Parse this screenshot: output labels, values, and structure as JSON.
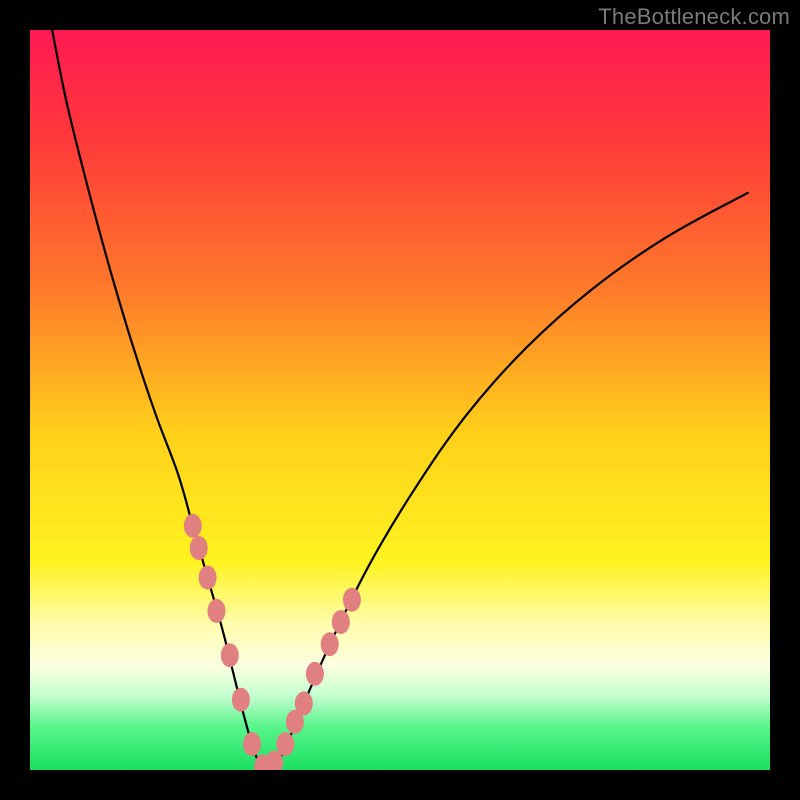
{
  "watermark": "TheBottleneck.com",
  "colors": {
    "frame": "#000000",
    "curve": "#000000",
    "marker_fill": "#e08080",
    "marker_stroke": "#c86868",
    "gradient_stops": [
      {
        "offset": 0.0,
        "color": "#ff1a52"
      },
      {
        "offset": 0.15,
        "color": "#ff3a3a"
      },
      {
        "offset": 0.35,
        "color": "#ff7a2a"
      },
      {
        "offset": 0.55,
        "color": "#ffd21a"
      },
      {
        "offset": 0.72,
        "color": "#fff321"
      },
      {
        "offset": 0.8,
        "color": "#fffca8"
      },
      {
        "offset": 0.86,
        "color": "#fbffe2"
      },
      {
        "offset": 0.9,
        "color": "#c4ffd0"
      },
      {
        "offset": 0.94,
        "color": "#5cf58c"
      },
      {
        "offset": 1.0,
        "color": "#18e060"
      }
    ]
  },
  "chart_data": {
    "type": "line",
    "title": "",
    "xlabel": "",
    "ylabel": "",
    "xlim": [
      0,
      100
    ],
    "ylim": [
      0,
      100
    ],
    "series": [
      {
        "name": "bottleneck-curve",
        "x": [
          3,
          5,
          8,
          11,
          14,
          17,
          20,
          22,
          24,
          26,
          27.5,
          29,
          30.5,
          32,
          34,
          37,
          41,
          46,
          52,
          59,
          67,
          76,
          86,
          97
        ],
        "values": [
          100,
          90,
          78,
          67,
          57,
          48,
          40,
          33,
          26,
          19,
          13,
          7,
          2,
          0,
          2,
          9,
          18,
          28,
          38,
          48,
          57,
          65,
          72,
          78
        ]
      }
    ],
    "markers": {
      "name": "highlighted-points",
      "x": [
        22.0,
        22.8,
        24.0,
        25.2,
        27.0,
        28.5,
        30.0,
        31.5,
        33.0,
        34.5,
        35.8,
        37.0,
        38.5,
        40.5,
        42.0,
        43.5
      ],
      "values": [
        33.0,
        30.0,
        26.0,
        21.5,
        15.5,
        9.5,
        3.5,
        0.5,
        1.0,
        3.5,
        6.5,
        9.0,
        13.0,
        17.0,
        20.0,
        23.0
      ]
    }
  }
}
